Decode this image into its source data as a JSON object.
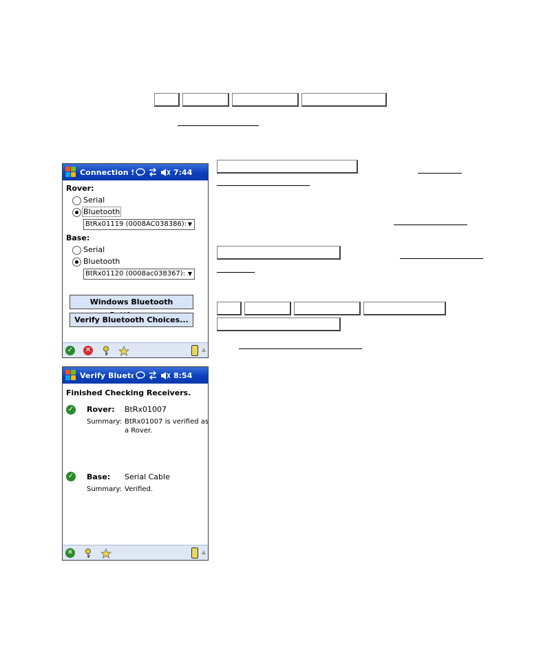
{
  "screen1": {
    "title": "Connection Set",
    "clock": "7:44",
    "rover_label": "Rover:",
    "rover_serial": "Serial",
    "rover_bluetooth": "Bluetooth",
    "rover_device": "BtRx01119 (0008AC038386):",
    "base_label": "Base:",
    "base_serial": "Serial",
    "base_bluetooth": "Bluetooth",
    "base_device": "BtRx01120 (0008ac038367)::",
    "windows_bt_button": "Windows Bluetooth Settings...",
    "verify_bt_button": "Verify Bluetooth Choices...",
    "icons": {
      "ok": "check-icon",
      "cancel": "cancel-icon",
      "help": "help-key-icon",
      "favorite": "star-icon",
      "receiver": "receiver-icon"
    }
  },
  "screen2": {
    "title": "Verify Bluetoot",
    "clock": "8:54",
    "heading": "Finished Checking Receivers.",
    "rover_label": "Rover:",
    "rover_value": "BtRx01007",
    "summary_label": "Summary:",
    "rover_summary_line1": "BtRx01007 is verified as",
    "rover_summary_line2": "a Rover.",
    "base_label": "Base:",
    "base_value": "Serial Cable",
    "base_summary": "Verified."
  },
  "colors": {
    "titlebar": "#0a3fbd",
    "menubar": "#dfe7f5",
    "button_fill": "#d7e3f7",
    "check_green": "#2a8a2a",
    "cancel_red": "#d43030"
  }
}
